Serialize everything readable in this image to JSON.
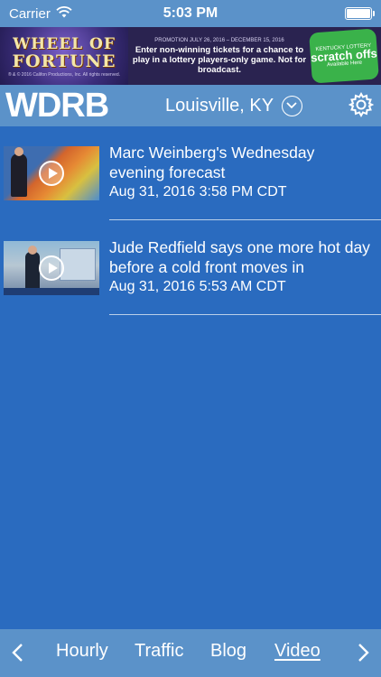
{
  "status_bar": {
    "carrier": "Carrier",
    "time": "5:03 PM"
  },
  "ad": {
    "logo_line1": "WHEEL OF",
    "logo_line2": "FORTUNE",
    "logo_copyright": "® & © 2016 Califon Productions, Inc. All rights reserved.",
    "promo_dates": "PROMOTION JULY 26, 2016 – DECEMBER 15, 2016",
    "body": "Enter non-winning tickets for a chance to play in a lottery players-only game. Not for broadcast.",
    "badge_top": "KENTUCKY LOTTERY",
    "badge_main": "scratch offs",
    "badge_bottom": "Available Here"
  },
  "app_bar": {
    "brand": "WDRB",
    "location": "Louisville, KY",
    "location_icon": "chevron-down-circle-icon",
    "settings_icon": "gear-icon"
  },
  "videos": [
    {
      "title": "Marc Weinberg's Wednesday evening forecast",
      "date": "Aug 31, 2016 3:58 PM CDT"
    },
    {
      "title": "Jude Redfield says one more hot day before a cold front moves in",
      "date": "Aug 31, 2016 5:53 AM CDT"
    }
  ],
  "tab_bar": {
    "prev_icon": "chevron-left-icon",
    "next_icon": "chevron-right-icon",
    "tabs": [
      {
        "label": "Hourly"
      },
      {
        "label": "Traffic"
      },
      {
        "label": "Blog"
      },
      {
        "label": "Video",
        "active": true
      }
    ]
  },
  "colors": {
    "background": "#2a6bbf",
    "bars": "#5b92c9",
    "text": "#ffffff"
  }
}
